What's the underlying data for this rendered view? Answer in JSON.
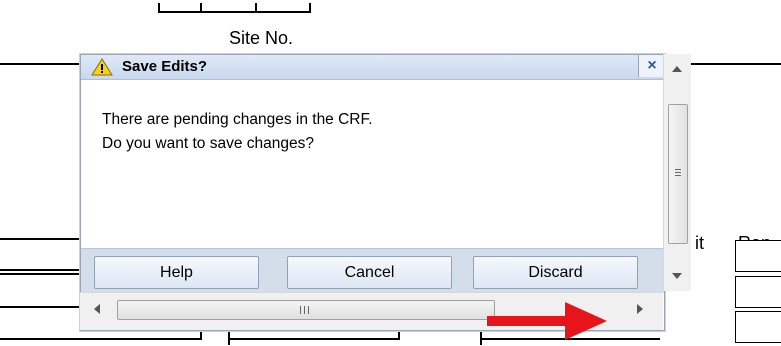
{
  "background_form": {
    "site_label": "Site No.",
    "unit_fragment": "it",
    "ran_fragment": "Ran"
  },
  "dialog": {
    "title": "Save Edits?",
    "close_glyph": "×",
    "message_line1": "There are pending changes in the CRF.",
    "message_line2": "Do you want to save changes?",
    "buttons": {
      "help": "Help",
      "cancel": "Cancel",
      "discard": "Discard"
    }
  },
  "scrollbars": {
    "vertical_grip": "≡",
    "horizontal_grip": "III"
  },
  "colors": {
    "annotation_arrow": "#e8141b",
    "warning_fill": "#f5d21c"
  },
  "icons": [
    "warning-icon",
    "close-icon",
    "scroll-up-icon",
    "scroll-down-icon",
    "scroll-left-icon",
    "scroll-right-icon"
  ]
}
